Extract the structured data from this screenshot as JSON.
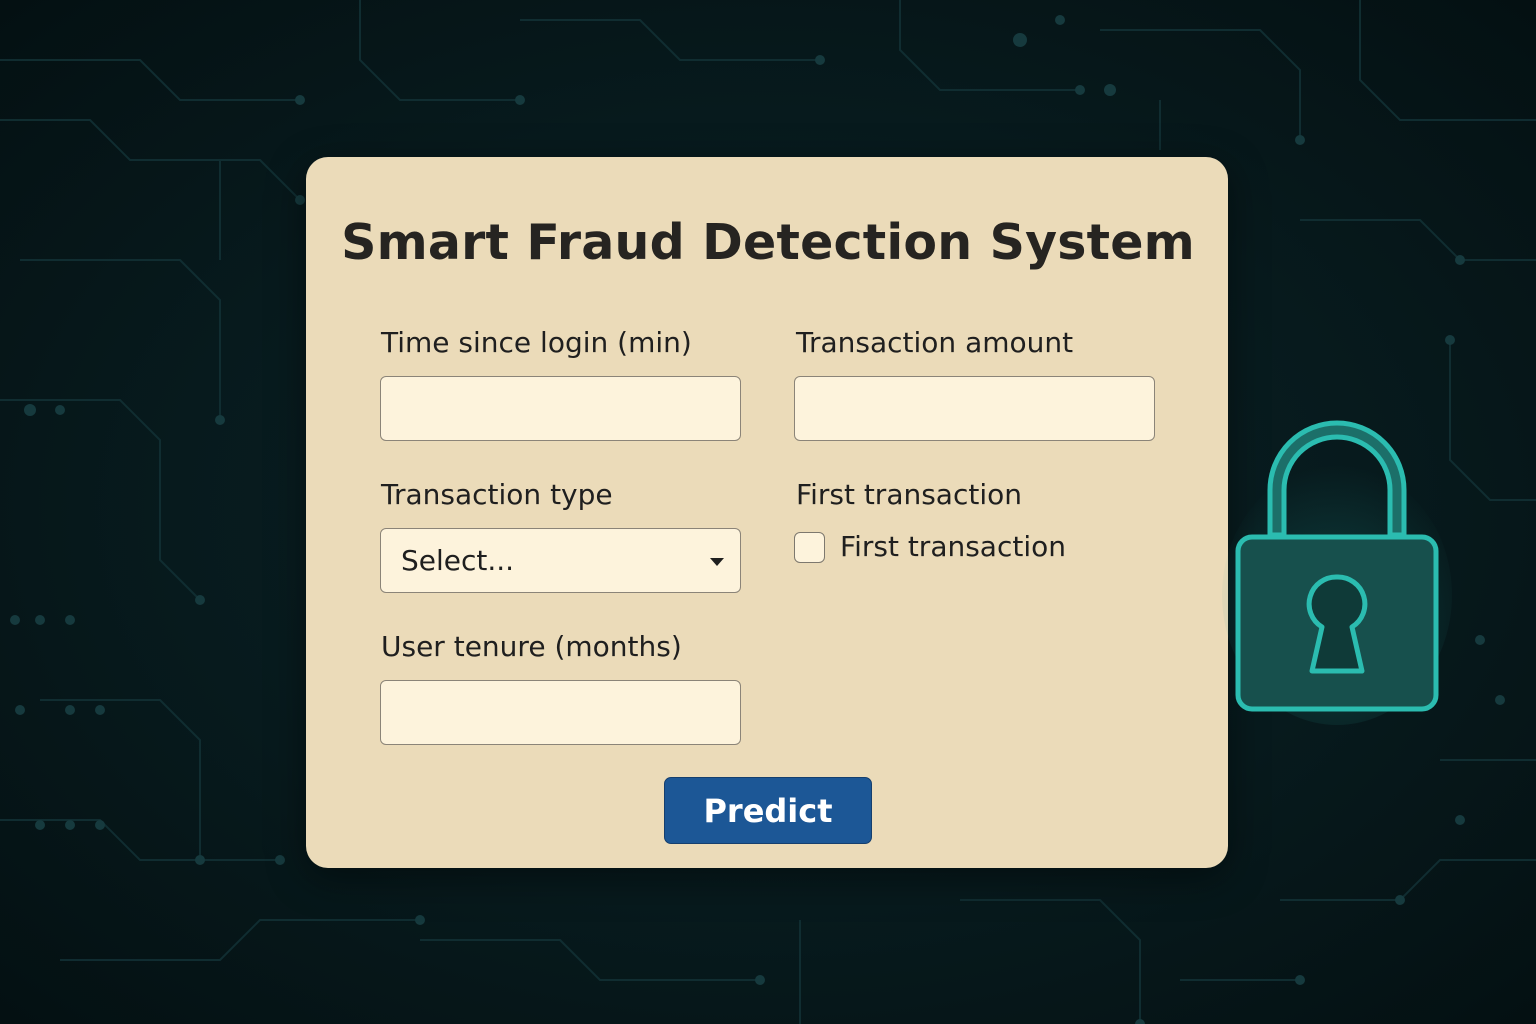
{
  "app": {
    "title": "Smart Fraud Detection System"
  },
  "form": {
    "time_since_login": {
      "label": "Time since login (min)",
      "value": "",
      "placeholder": ""
    },
    "transaction_amount": {
      "label": "Transaction amount",
      "value": "",
      "placeholder": ""
    },
    "transaction_type": {
      "label": "Transaction type",
      "selected": "Select..."
    },
    "first_transaction": {
      "label": "First transaction",
      "checkbox_label": "First transaction",
      "checked": false
    },
    "user_tenure": {
      "label": "User tenure (months)",
      "value": "",
      "placeholder": ""
    }
  },
  "actions": {
    "predict_label": "Predict"
  },
  "icons": {
    "lock": "padlock-icon",
    "caret": "chevron-down-icon"
  },
  "colors": {
    "background": "#06161a",
    "card": "#ebdbb9",
    "input": "#fdf3dc",
    "accent_button": "#1c5796",
    "lock_teal": "#2ab3a6"
  }
}
